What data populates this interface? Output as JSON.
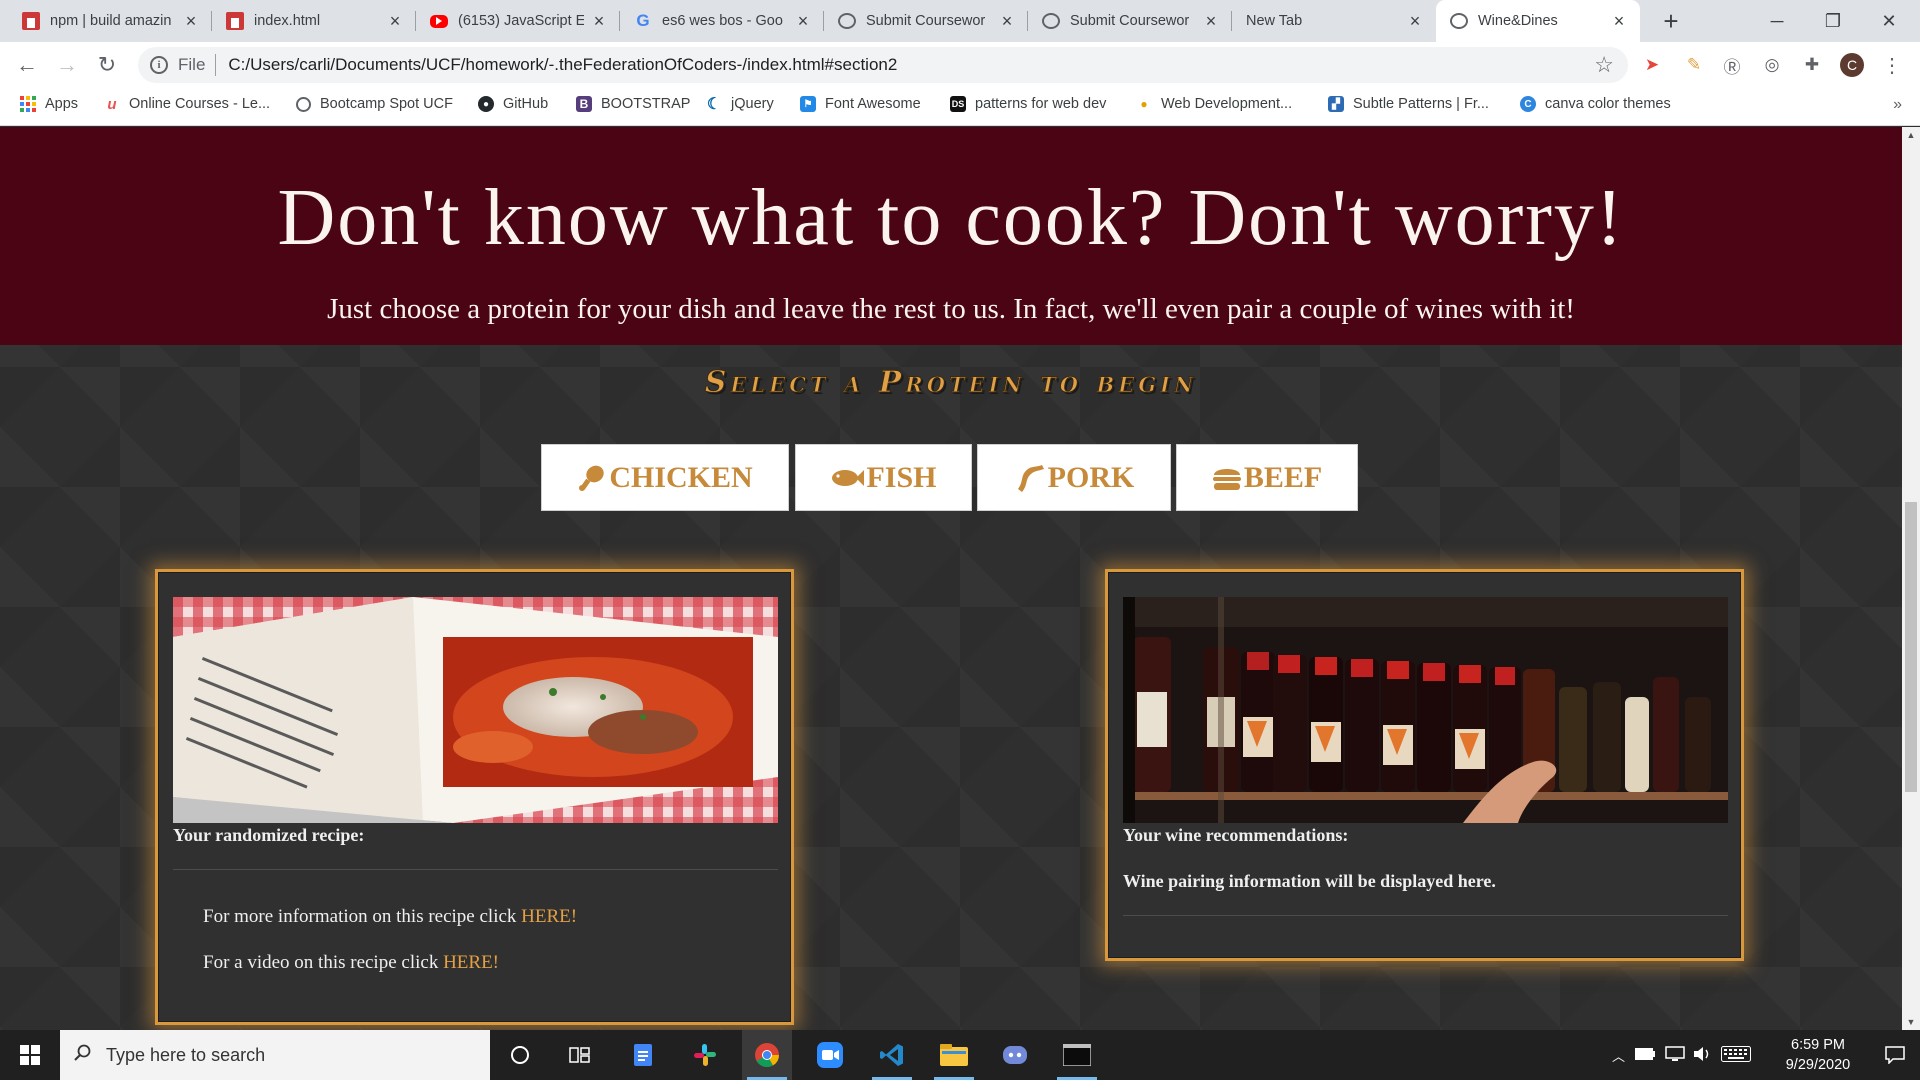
{
  "browser": {
    "tabs": [
      {
        "title": "npm | build amazin",
        "favicon": "npm-icon"
      },
      {
        "title": "index.html",
        "favicon": "npm-icon"
      },
      {
        "title": "(6153) JavaScript E",
        "favicon": "youtube-icon"
      },
      {
        "title": "es6 wes bos - Goo",
        "favicon": "google-icon"
      },
      {
        "title": "Submit Coursewor",
        "favicon": "globe-icon"
      },
      {
        "title": "Submit Coursewor",
        "favicon": "globe-icon"
      },
      {
        "title": "New Tab",
        "favicon": ""
      },
      {
        "title": "Wine&Dines",
        "favicon": "globe-icon",
        "active": true
      }
    ],
    "address": {
      "scheme_label": "File",
      "url": "C:/Users/carli/Documents/UCF/homework/-.theFederationOfCoders-/index.html#section2"
    },
    "profile_initial": "C",
    "bookmarks": [
      {
        "label": "Apps",
        "icon": "apps-grid-icon"
      },
      {
        "label": "Online Courses - Le...",
        "icon": "udemy-icon"
      },
      {
        "label": "Bootcamp Spot UCF",
        "icon": "globe-icon"
      },
      {
        "label": "GitHub",
        "icon": "github-icon"
      },
      {
        "label": "BOOTSTRAP",
        "icon": "bootstrap-icon"
      },
      {
        "label": "jQuery",
        "icon": "jquery-icon"
      },
      {
        "label": "Font Awesome",
        "icon": "font-awesome-icon"
      },
      {
        "label": "patterns for web dev",
        "icon": "ds-icon"
      },
      {
        "label": "Web Development...",
        "icon": "bulb-icon"
      },
      {
        "label": "Subtle Patterns | Fr...",
        "icon": "subtle-patterns-icon"
      },
      {
        "label": "canva color themes",
        "icon": "canva-icon"
      }
    ]
  },
  "hero": {
    "heading": "Don't know what to cook? Don't worry!",
    "subheading": "Just choose a protein for your dish and leave the rest to us. In fact, we'll even pair a couple of wines with it!"
  },
  "selector": {
    "title": "Select a Protein to begin",
    "buttons": [
      {
        "label": "CHICKEN",
        "icon": "drumstick-icon"
      },
      {
        "label": "FISH",
        "icon": "fish-icon"
      },
      {
        "label": "PORK",
        "icon": "bacon-icon"
      },
      {
        "label": "BEEF",
        "icon": "hamburger-icon"
      }
    ]
  },
  "recipe_card": {
    "label": "Your randomized recipe:",
    "more_info_text": "For more information on this recipe click",
    "more_info_link": "HERE!",
    "video_text": "For a video on this recipe click",
    "video_link": "HERE!"
  },
  "wine_card": {
    "label": "Your wine recommendations:",
    "placeholder": "Wine pairing information will be displayed here."
  },
  "taskbar": {
    "search_placeholder": "Type here to search",
    "time": "6:59 PM",
    "date": "9/29/2020"
  },
  "colors": {
    "hero_bg": "#4a0413",
    "accent_gold": "#d9983c",
    "button_text": "#c68a3a"
  }
}
